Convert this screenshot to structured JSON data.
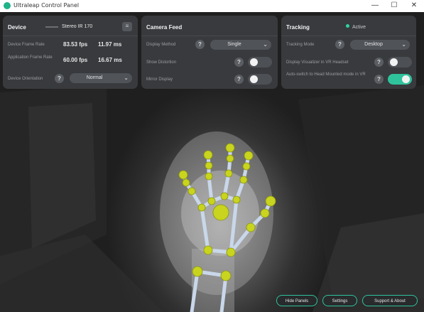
{
  "window": {
    "title": "Ultraleap Control Panel",
    "controls": {
      "minimize": "—",
      "maximize": "☐",
      "close": "✕"
    }
  },
  "device_panel": {
    "heading": "Device",
    "device_name": "Stereo IR 170",
    "device_frame_rate": {
      "label": "Device Frame Rate",
      "fps": "83.53 fps",
      "ms": "11.97 ms"
    },
    "application_frame_rate": {
      "label": "Application Frame Rate",
      "fps": "60.00 fps",
      "ms": "16.67 ms"
    },
    "device_orientation": {
      "label": "Device Orientation",
      "value": "Normal"
    }
  },
  "camera_panel": {
    "heading": "Camera Feed",
    "display_method": {
      "label": "Display Method",
      "value": "Single"
    },
    "show_distortion": {
      "label": "Show Distortion",
      "enabled": false
    },
    "mirror_display": {
      "label": "Mirror Display",
      "enabled": false
    }
  },
  "tracking_panel": {
    "heading": "Tracking",
    "status": "Active",
    "tracking_mode": {
      "label": "Tracking Mode",
      "value": "Desktop"
    },
    "display_visualizer": {
      "label": "Display Visualizer in VR Headset",
      "enabled": false
    },
    "auto_switch": {
      "label": "Auto-switch to Head Mounted mode in VR",
      "enabled": true
    }
  },
  "help_glyph": "?",
  "footer": {
    "hide_panels": "Hide Panels",
    "settings": "Settings",
    "support": "Support & About"
  },
  "colors": {
    "accent": "#2fc39c",
    "joint": "#c8d41e",
    "bone": "#c9d7ea",
    "status_dot": "#2fd39f"
  },
  "icons": {
    "app": "ultraleap-logo-icon",
    "menu": "menu-icon",
    "chevron": "chevron-down-icon",
    "help": "help-icon"
  }
}
